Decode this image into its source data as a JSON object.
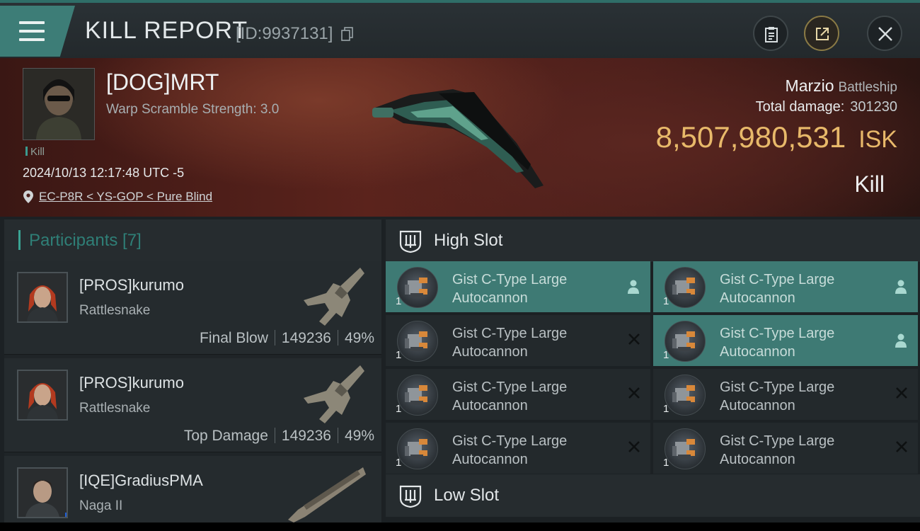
{
  "header": {
    "title": "KILL REPORT",
    "report_id": "[ID:9937131]"
  },
  "victim": {
    "pilot_name": "[DOG]MRT",
    "warp_scramble": "Warp Scramble Strength: 3.0",
    "kill_tag": "Kill",
    "datetime": "2024/10/13 12:17:48 UTC -5",
    "location": "EC-P8R < YS-GOP < Pure Blind",
    "ship_name": "Marzio",
    "ship_class": "Battleship",
    "total_damage_label": "Total damage:",
    "total_damage": "301230",
    "isk_value": "8,507,980,531",
    "isk_unit": "ISK",
    "result": "Kill"
  },
  "participants": {
    "title": "Participants [7]",
    "rows": [
      {
        "name": "[PROS]kurumo",
        "ship": "Rattlesnake",
        "role": "Final Blow",
        "damage": "149236",
        "percent": "49%"
      },
      {
        "name": "[PROS]kurumo",
        "ship": "Rattlesnake",
        "role": "Top Damage",
        "damage": "149236",
        "percent": "49%"
      },
      {
        "name": "[IQE]GradiusPMA",
        "ship": "Naga II",
        "role": "",
        "damage": "",
        "percent": ""
      }
    ]
  },
  "slots": {
    "high_title": "High Slot",
    "low_title": "Low Slot",
    "high_modules": [
      {
        "line1": "Gist C-Type Large",
        "line2": "Autocannon",
        "qty": "1",
        "status": "dropped"
      },
      {
        "line1": "Gist C-Type Large",
        "line2": "Autocannon",
        "qty": "1",
        "status": "dropped"
      },
      {
        "line1": "Gist C-Type Large",
        "line2": "Autocannon",
        "qty": "1",
        "status": "destroyed"
      },
      {
        "line1": "Gist C-Type Large",
        "line2": "Autocannon",
        "qty": "1",
        "status": "dropped"
      },
      {
        "line1": "Gist C-Type Large",
        "line2": "Autocannon",
        "qty": "1",
        "status": "destroyed"
      },
      {
        "line1": "Gist C-Type Large",
        "line2": "Autocannon",
        "qty": "1",
        "status": "destroyed"
      },
      {
        "line1": "Gist C-Type Large",
        "line2": "Autocannon",
        "qty": "1",
        "status": "destroyed"
      },
      {
        "line1": "Gist C-Type Large",
        "line2": "Autocannon",
        "qty": "1",
        "status": "destroyed"
      }
    ]
  },
  "colors": {
    "accent": "#3e7a74",
    "isk": "#e8b96a",
    "banner": "#5b231c"
  }
}
